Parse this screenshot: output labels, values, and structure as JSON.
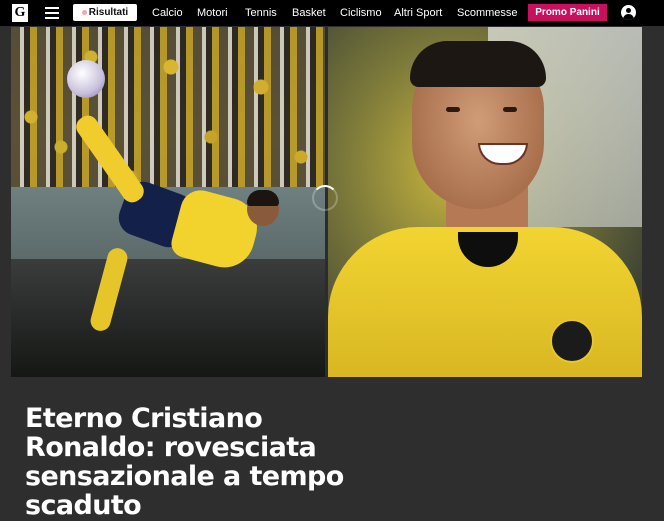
{
  "header": {
    "logo_letter": "G",
    "risultati_label": "Risultati",
    "nav": [
      "Calcio",
      "Motori",
      "Tennis",
      "Basket",
      "Ciclismo",
      "Altri Sport",
      "Scommesse"
    ],
    "promo_label": "Promo Panini",
    "colors": {
      "bar": "#000000",
      "promo": "#c8105e"
    }
  },
  "article": {
    "headline": "Eterno Cristiano Ronaldo: rovesciata sensazionale a tempo scaduto"
  }
}
